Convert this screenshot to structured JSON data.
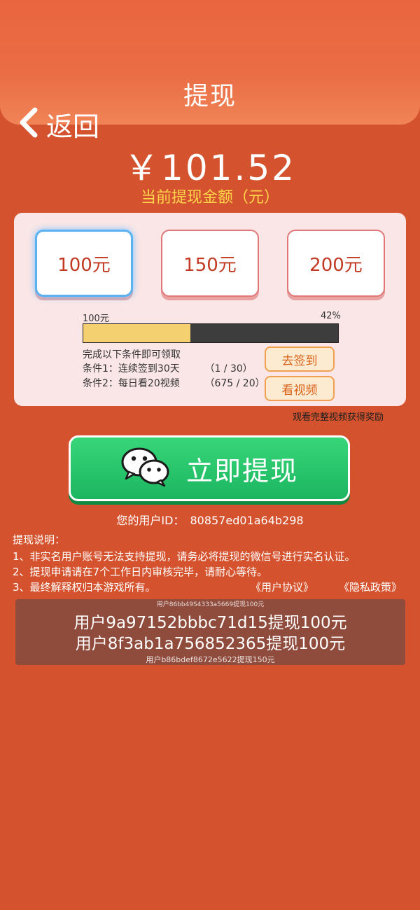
{
  "header": {
    "title": "提现",
    "back_label": "返回"
  },
  "balance": {
    "amount": "￥101.52",
    "caption": "当前提现金额（元）"
  },
  "options": [
    {
      "label": "100元",
      "selected": true
    },
    {
      "label": "150元",
      "selected": false
    },
    {
      "label": "200元",
      "selected": false
    }
  ],
  "progress": {
    "left_label": "100元",
    "right_label": "42%",
    "fraction": 0.42
  },
  "conditions": {
    "title": "完成以下条件即可领取",
    "items": [
      {
        "text": "条件1：连续签到30天",
        "count": "（1 / 30）",
        "button": "去签到"
      },
      {
        "text": "条件2：每日看20视频",
        "count": "（675 / 20）",
        "button": "看视频"
      }
    ]
  },
  "reward_note": "观看完整视频获得奖励",
  "withdraw_button": {
    "label": "立即提现",
    "icon": "wechat-icon"
  },
  "user": {
    "id_label": "您的用户ID：",
    "id_value": "80857ed01a64b298"
  },
  "notes": {
    "title": "提现说明：",
    "items": [
      "1、非实名用户账号无法支持提现，请务必将提现的微信号进行实名认证。",
      "2、提现申请请在7个工作日内审核完毕，请耐心等待。",
      "3、最终解释权归本游戏所有。"
    ],
    "links": {
      "agreement": "《用户协议》",
      "privacy": "《隐私政策》"
    }
  },
  "ticker": {
    "top_small": "用户86bb49S4333a5669提现100元",
    "line1": "用户9a97152bbbc71d15提现100元",
    "line2": "用户8f3ab1a756852365提现100元",
    "bottom_small": "用户b86bdef8672e5622提现150元"
  },
  "colors": {
    "background": "#d4532e",
    "accent_yellow": "#ffd54a",
    "button_green": "#1bb660",
    "progress_fill": "#f4d070",
    "selected_border": "#5ab2f2"
  }
}
